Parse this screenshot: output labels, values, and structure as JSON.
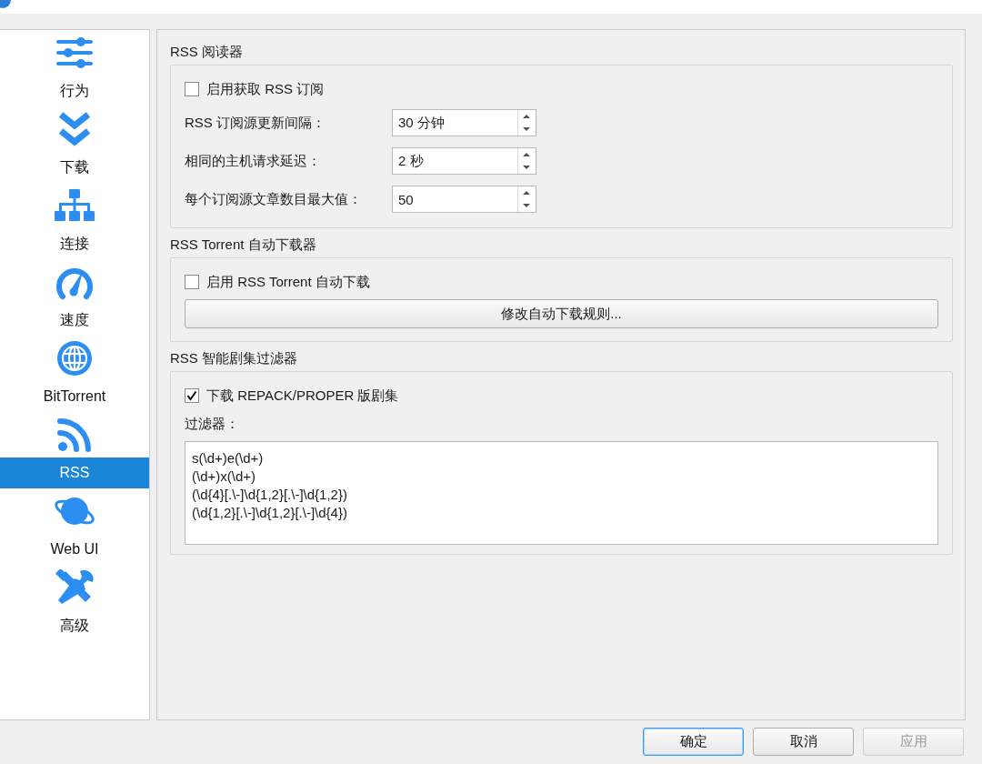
{
  "sidebar": {
    "items": [
      {
        "label": "行为",
        "selected": false
      },
      {
        "label": "下载",
        "selected": false
      },
      {
        "label": "连接",
        "selected": false
      },
      {
        "label": "速度",
        "selected": false
      },
      {
        "label": "BitTorrent",
        "selected": false
      },
      {
        "label": "RSS",
        "selected": true
      },
      {
        "label": "Web UI",
        "selected": false
      },
      {
        "label": "高级",
        "selected": false
      }
    ]
  },
  "sections": [
    {
      "title": "RSS 阅读器",
      "rows": [
        {
          "kind": "checkbox",
          "label": "启用获取 RSS 订阅",
          "checked": false
        },
        {
          "kind": "spinbox",
          "label": "RSS 订阅源更新间隔：",
          "value": "30 分钟"
        },
        {
          "kind": "spinbox",
          "label": "相同的主机请求延迟：",
          "value": "2 秒"
        },
        {
          "kind": "spinbox",
          "label": "每个订阅源文章数目最大值：",
          "value": "50"
        }
      ]
    },
    {
      "title": "RSS Torrent 自动下载器",
      "rows": [
        {
          "kind": "checkbox",
          "label": "启用 RSS Torrent 自动下载",
          "checked": false
        },
        {
          "kind": "button",
          "label": "修改自动下载规则..."
        }
      ]
    },
    {
      "title": "RSS 智能剧集过滤器",
      "rows": [
        {
          "kind": "checkbox",
          "label": "下载 REPACK/PROPER 版剧集",
          "checked": true
        },
        {
          "kind": "label",
          "label": "过滤器："
        },
        {
          "kind": "textarea",
          "lines": [
            "s(\\d+)e(\\d+)",
            "(\\d+)x(\\d+)",
            "(\\d{4}[.\\-]\\d{1,2}[.\\-]\\d{1,2})",
            "(\\d{1,2}[.\\-]\\d{1,2}[.\\-]\\d{4})"
          ]
        }
      ]
    }
  ],
  "buttons": [
    {
      "label": "确定",
      "default": true,
      "disabled": false
    },
    {
      "label": "取消",
      "default": false,
      "disabled": false
    },
    {
      "label": "应用",
      "default": false,
      "disabled": true
    }
  ]
}
